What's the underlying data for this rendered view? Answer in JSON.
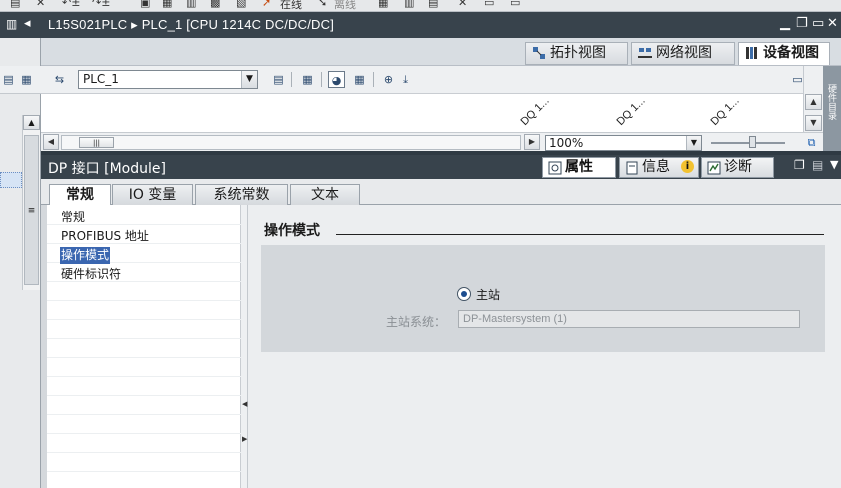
{
  "project": {
    "title": "L15S021PLC ▸ PLC_1 [CPU 1214C DC/DC/DC]"
  },
  "toolbar_top": {
    "online_label": "在线",
    "offline_label": "离线"
  },
  "view_tabs": [
    {
      "label": "拓扑视图",
      "icon": "topology-icon"
    },
    {
      "label": "网络视图",
      "icon": "network-icon"
    },
    {
      "label": "设备视图",
      "icon": "device-icon",
      "active": true
    }
  ],
  "device_toolbar": {
    "device_select_value": "PLC_1"
  },
  "canvas": {
    "module_labels": [
      "DQ 1...",
      "DQ 1...",
      "DQ 1..."
    ],
    "zoom_value": "100%"
  },
  "task_strip": {
    "label": "硬件目录"
  },
  "inspector": {
    "title": "DP 接口 [Module]",
    "tabs": [
      {
        "label": "属性",
        "active": true
      },
      {
        "label": "信息"
      },
      {
        "label": "诊断"
      }
    ]
  },
  "property_tabs": [
    {
      "label": "常规",
      "active": true
    },
    {
      "label": "IO 变量"
    },
    {
      "label": "系统常数"
    },
    {
      "label": "文本"
    }
  ],
  "nav_items": [
    {
      "label": "常规"
    },
    {
      "label": "PROFIBUS 地址"
    },
    {
      "label": "操作模式",
      "selected": true
    },
    {
      "label": "硬件标识符"
    }
  ],
  "operation_mode": {
    "section_title": "操作模式",
    "radio_label": "主站",
    "master_system_label": "主站系统：",
    "master_system_value": "DP-Mastersystem (1)"
  },
  "colors": {
    "title_bar": "#38434c",
    "selection": "#3a66b0"
  }
}
